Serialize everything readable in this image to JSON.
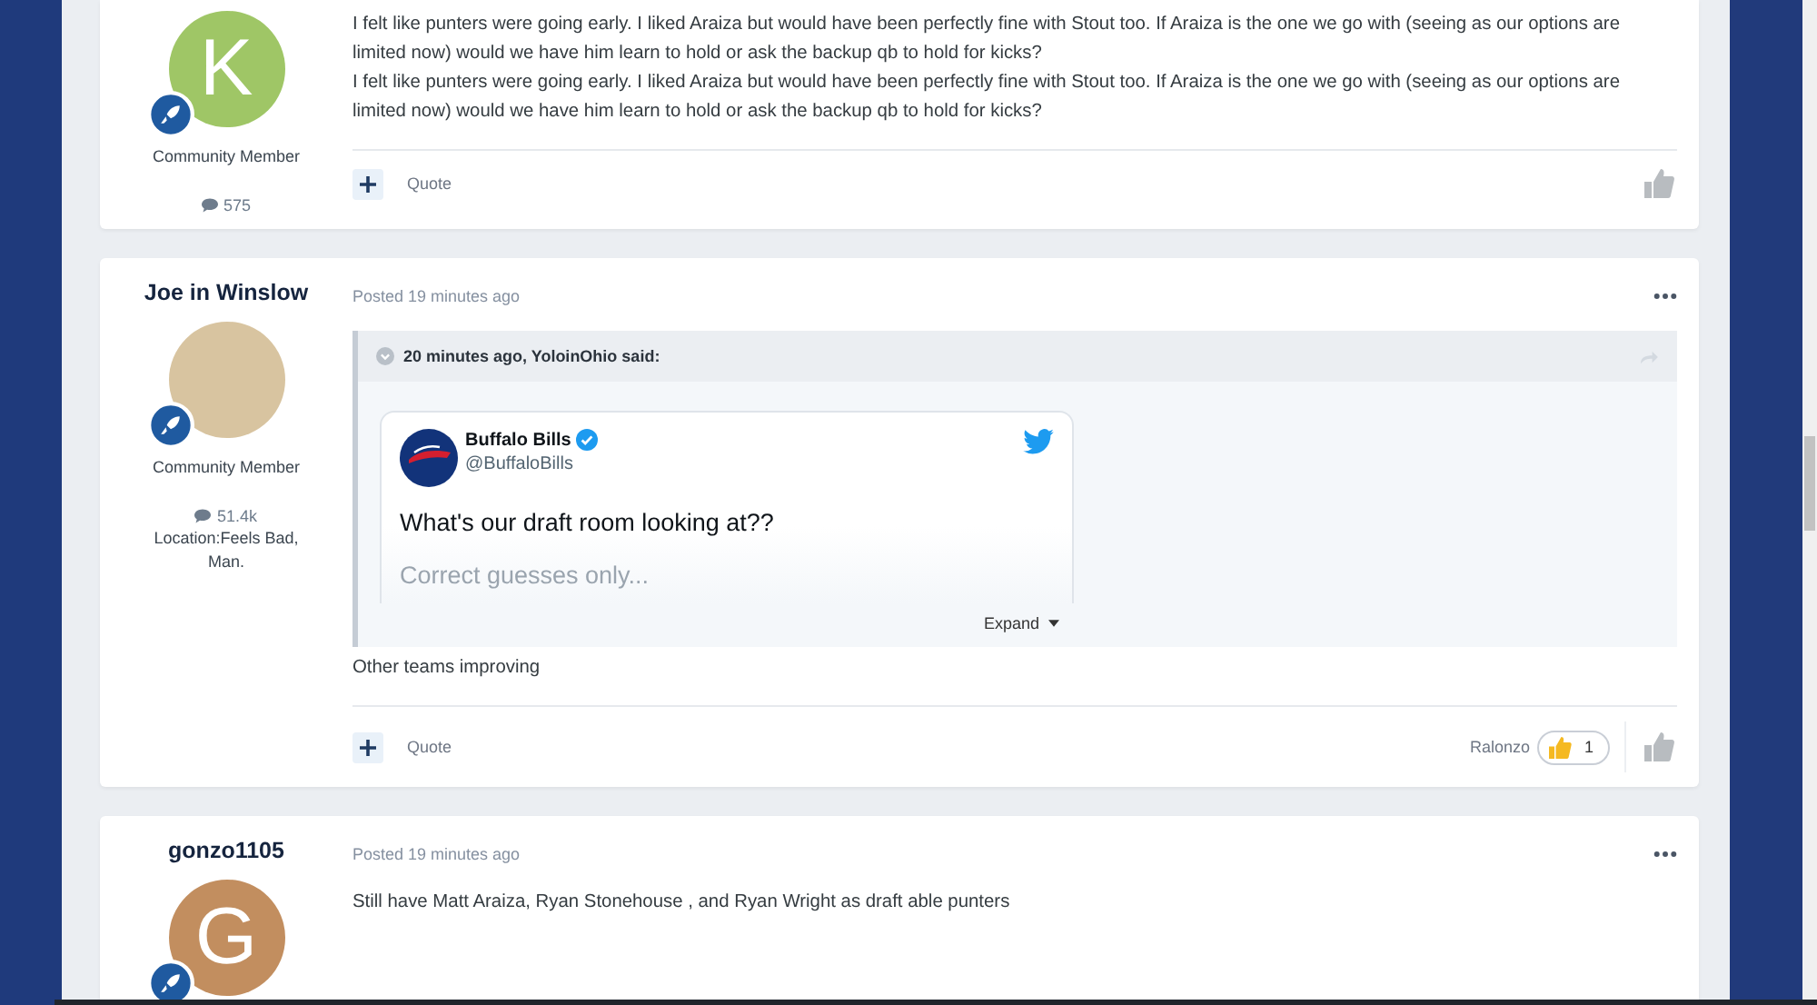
{
  "posts": [
    {
      "avatar": {
        "kind": "letter",
        "letter": "K",
        "color": "#9fc666"
      },
      "rank": "Community Member",
      "post_count": "575",
      "body": [
        "I felt like punters were going early. I liked Araiza but would have been perfectly fine with Stout too. If Araiza is the one we go with (seeing as our options are limited now) would we have him learn to hold or ask the backup qb to hold for kicks?",
        "I felt like punters were going early. I liked Araiza but would have been perfectly fine with Stout too. If Araiza is the one we go with (seeing as our options are limited now) would we have him learn to hold or ask the backup qb to hold for kicks?"
      ],
      "footer": {
        "quote_label": "Quote"
      }
    },
    {
      "author": "Joe in Winslow",
      "posted": "Posted 19 minutes ago",
      "avatar": {
        "kind": "photo"
      },
      "rank": "Community Member",
      "post_count": "51.4k",
      "location": "Location:Feels Bad, Man.",
      "quote": {
        "header": "20 minutes ago, YoloinOhio said:",
        "tweet": {
          "name": "Buffalo Bills",
          "verified": true,
          "handle": "@BuffaloBills",
          "text": "What's our draft room looking at??",
          "faded_text": "Correct guesses only...",
          "expand_label": "Expand"
        }
      },
      "body": [
        "Other teams improving"
      ],
      "footer": {
        "quote_label": "Quote",
        "reaction": {
          "user": "Ralonzo",
          "count": "1"
        }
      }
    },
    {
      "author": "gonzo1105",
      "posted": "Posted 19 minutes ago",
      "avatar": {
        "kind": "letter",
        "letter": "G",
        "color": "#c28e5f"
      },
      "body": [
        "Still have Matt Araiza, Ryan Stonehouse , and Ryan Wright as draft able punters"
      ]
    }
  ]
}
